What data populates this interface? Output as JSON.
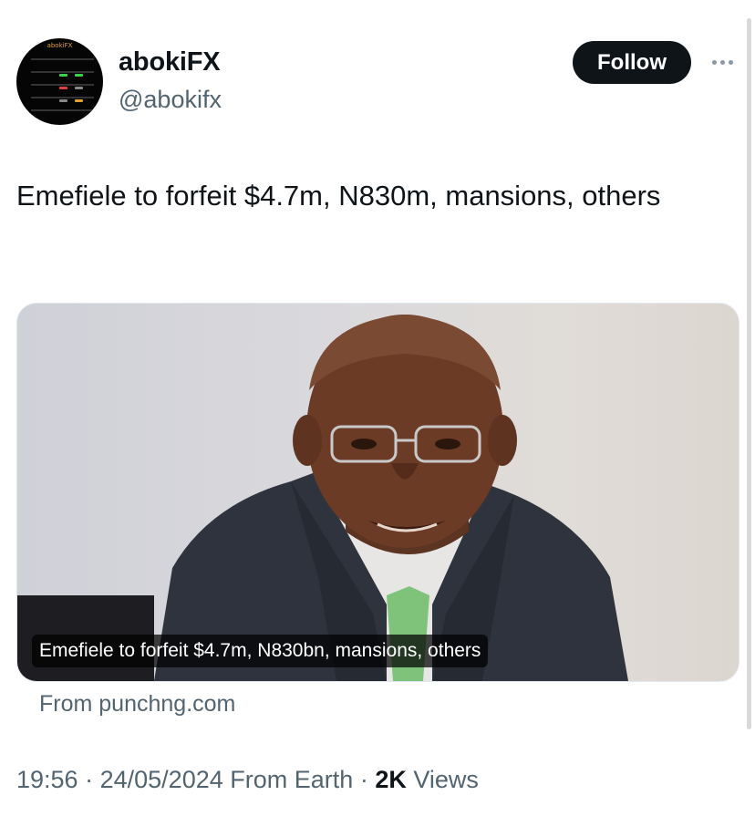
{
  "author": {
    "display_name": "abokiFX",
    "handle": "@abokifx",
    "avatar_text": "abokiFX"
  },
  "follow_label": "Follow",
  "tweet": {
    "text": "Emefiele to forfeit $4.7m, N830m, mansions, others"
  },
  "card": {
    "image_caption": "Emefiele to forfeit $4.7m, N830bn, mansions, others",
    "source": "From punchng.com"
  },
  "meta": {
    "time": "19:56",
    "separator": "·",
    "date": "24/05/2024",
    "source": "From Earth",
    "views_count": "2K",
    "views_label": "Views"
  },
  "colors": {
    "text": "#0f1419",
    "secondary": "#536471",
    "follow_bg": "#0f1419"
  }
}
